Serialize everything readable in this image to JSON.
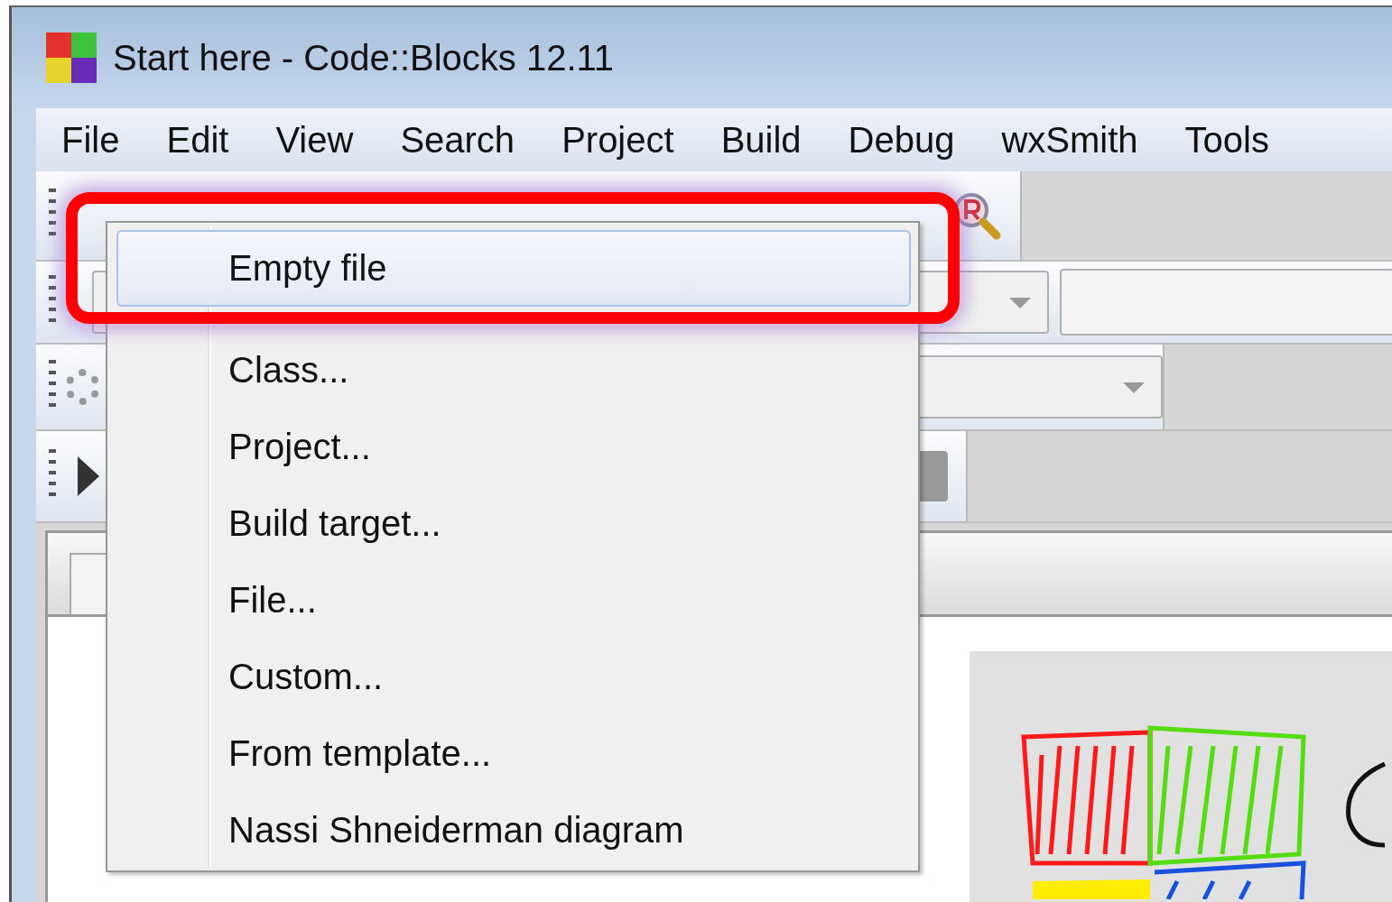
{
  "window": {
    "title": "Start here - Code::Blocks 12.11"
  },
  "menu_bar": [
    "File",
    "Edit",
    "View",
    "Search",
    "Project",
    "Build",
    "Debug",
    "wxSmith",
    "Tools"
  ],
  "popup_menu": {
    "items": [
      {
        "label": "Empty file",
        "selected": true,
        "separator_after": true
      },
      {
        "label": "Class...",
        "selected": false,
        "separator_after": false
      },
      {
        "label": "Project...",
        "selected": false,
        "separator_after": false
      },
      {
        "label": "Build target...",
        "selected": false,
        "separator_after": false
      },
      {
        "label": "File...",
        "selected": false,
        "separator_after": false
      },
      {
        "label": "Custom...",
        "selected": false,
        "separator_after": false
      },
      {
        "label": "From template...",
        "selected": false,
        "separator_after": false
      },
      {
        "label": "Nassi Shneiderman diagram",
        "selected": false,
        "separator_after": false
      }
    ]
  }
}
